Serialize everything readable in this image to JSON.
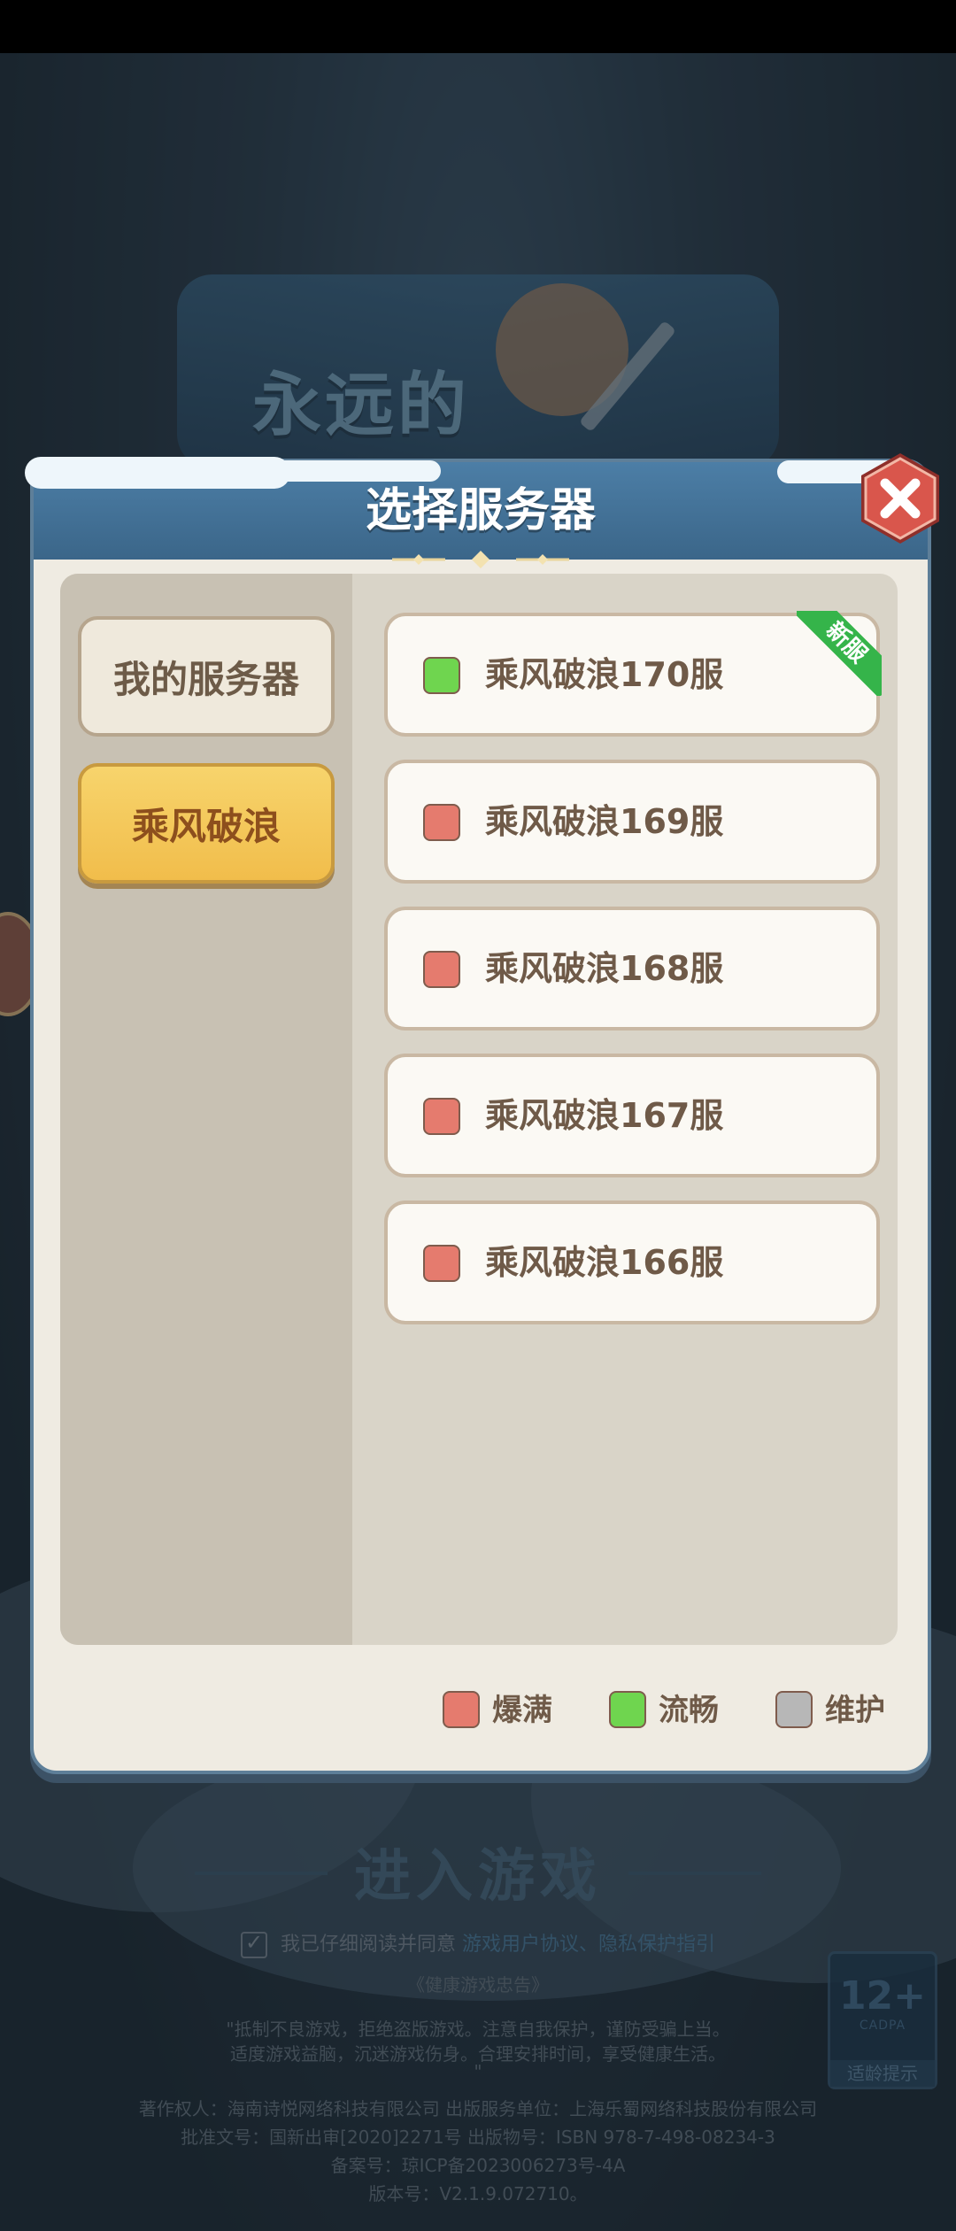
{
  "dialog": {
    "title": "选择服务器",
    "categories": [
      {
        "label": "我的服务器",
        "active": false
      },
      {
        "label": "乘风破浪",
        "active": true
      }
    ],
    "servers": [
      {
        "name": "乘风破浪170服",
        "status": "smooth",
        "badge": "新服"
      },
      {
        "name": "乘风破浪169服",
        "status": "full"
      },
      {
        "name": "乘风破浪168服",
        "status": "full"
      },
      {
        "name": "乘风破浪167服",
        "status": "full"
      },
      {
        "name": "乘风破浪166服",
        "status": "full"
      }
    ],
    "legend": [
      {
        "label": "爆满",
        "status": "full"
      },
      {
        "label": "流畅",
        "status": "smooth"
      },
      {
        "label": "维护",
        "status": "maintenance"
      }
    ]
  },
  "status_colors": {
    "full": "#e57b6e",
    "smooth": "#6fd54f",
    "maintenance": "#b7b7b7"
  },
  "background": {
    "logo_text": "永远的",
    "enter_game": "进入游戏",
    "agree_prefix": "我已仔细阅读并同意",
    "agree_links": "游戏用户协议、隐私保护指引",
    "health_title": "《健康游戏忠告》",
    "health_line1": "\"抵制不良游戏，拒绝盗版游戏。注意自我保护，谨防受骗上当。",
    "health_line2": "适度游戏益脑，沉迷游戏伤身。合理安排时间，享受健康生活。",
    "health_line3": "\"",
    "copyright": "著作权人：海南诗悦网络科技有限公司 出版服务单位：上海乐蜀网络科技股份有限公司",
    "approval": "批准文号：国新出审[2020]2271号 出版物号：ISBN 978-7-498-08234-3",
    "icp": "备案号：琼ICP备2023006273号-4A",
    "version": "版本号：V2.1.9.072710。",
    "age_number": "12+",
    "age_sub": "CADPA",
    "age_tip": "适龄提示"
  }
}
